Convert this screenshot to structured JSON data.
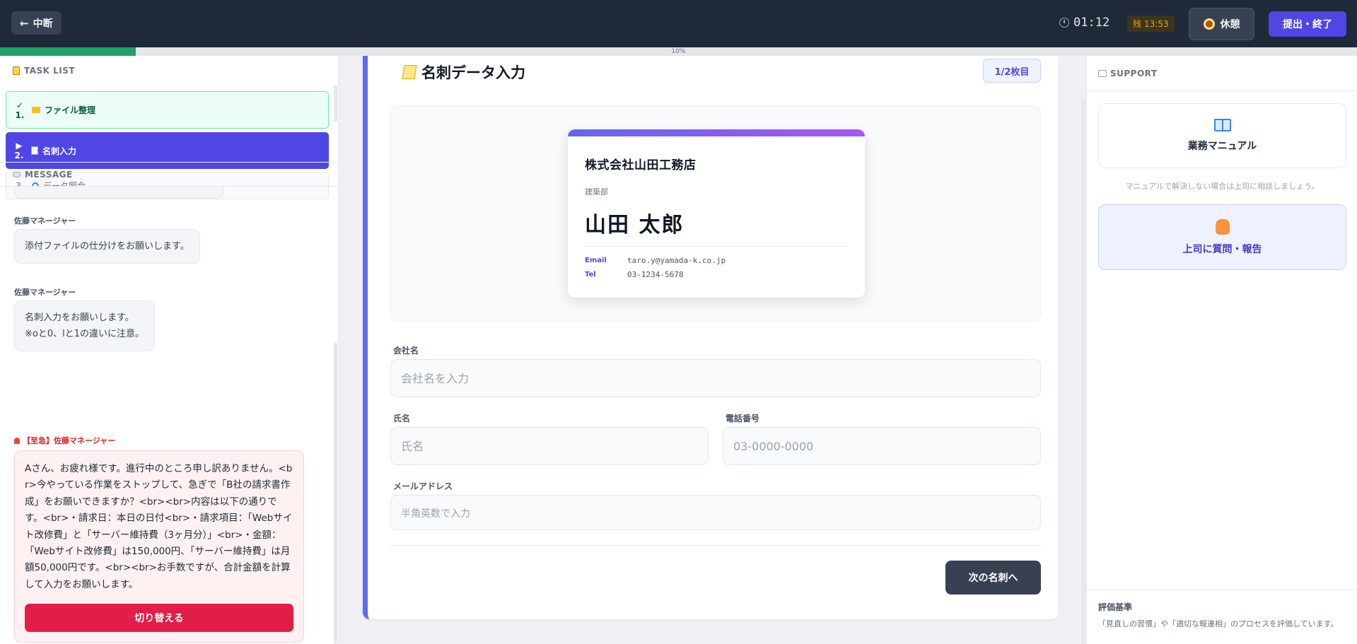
{
  "header": {
    "back_label": "中断",
    "timer": "01:12",
    "remaining_prefix": "残",
    "remaining": "13:53",
    "break_label": "休憩",
    "submit_label": "提出・終了"
  },
  "progress": {
    "percent": 10,
    "label": "10%"
  },
  "tasks": {
    "title": "TASK LIST",
    "items": [
      {
        "status": "✓",
        "num": "1.",
        "label": "ファイル整理"
      },
      {
        "status": "▶",
        "num": "2.",
        "label": "名刺入力"
      },
      {
        "status": "",
        "num": "3.",
        "label": "データ照合"
      }
    ]
  },
  "messages": {
    "title": "MESSAGE",
    "items": [
      {
        "sender": "佐藤マネージャー",
        "text": "添付ファイルの仕分けをお願いします。"
      },
      {
        "sender": "佐藤マネージャー",
        "line1": "名刺入力をお願いします。",
        "line2": "※oと0、lと1の違いに注意。"
      }
    ],
    "urgent": {
      "sender": "【至急】佐藤マネージャー",
      "text": "Aさん、お疲れ様です。進行中のところ申し訳ありません。<br>今やっている作業をストップして、急ぎで「B社の請求書作成」をお願いできますか？<br><br>内容は以下の通りです。<br>・請求日：本日の日付<br>・請求項目：「Webサイト改修費」と「サーバー維持費（3ヶ月分）」<br>・金額：「Webサイト改修費」は150,000円、「サーバー維持費」は月額50,000円です。<br><br>お手数ですが、合計金額を計算して入力をお願いします。",
      "button_label": "切り替える"
    }
  },
  "main": {
    "title": "名刺データ入力",
    "page_badge": "1/2枚目",
    "card": {
      "company": "株式会社山田工務店",
      "department": "建築部",
      "name": "山田 太郎",
      "email_label": "Email",
      "email": "taro.y@yamada-k.co.jp",
      "tel_label": "Tel",
      "tel": "03-1234-5678"
    },
    "form": {
      "company_label": "会社名",
      "company_placeholder": "会社名を入力",
      "name_label": "氏名",
      "name_placeholder": "氏名",
      "phone_label": "電話番号",
      "phone_placeholder": "03-0000-0000",
      "email_label": "メールアドレス",
      "email_placeholder": "半角英数で入力"
    },
    "next_label": "次の名刺へ"
  },
  "support": {
    "title": "SUPPORT",
    "manual_label": "業務マニュアル",
    "manual_note": "マニュアルで解決しない場合は上司に相談しましょう。",
    "ask_label": "上司に質問・報告",
    "eval_title": "評価基準",
    "eval_text": "「見直しの習慣」や「適切な報連相」のプロセスを評価しています。"
  },
  "colors": {
    "accent": "#4f46e5",
    "urgent": "#e11d48",
    "done": "#22a06b"
  }
}
